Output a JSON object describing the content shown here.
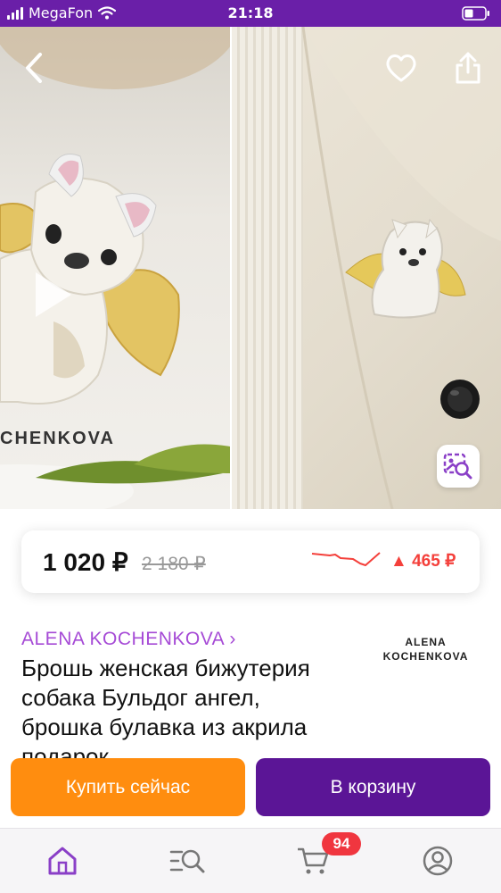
{
  "status_bar": {
    "carrier": "MegaFon",
    "time": "21:18",
    "icons": [
      "signal-icon",
      "wifi-icon",
      "battery-icon"
    ]
  },
  "gallery": {
    "watermark": "CHENKOVA",
    "icons": {
      "back": "chevron-left-icon",
      "favorite": "heart-icon",
      "share": "share-icon",
      "visual_search": "image-search-icon"
    }
  },
  "price": {
    "current": "1 020 ₽",
    "old": "2 180 ₽",
    "change": "▲ 465 ₽",
    "trend_color": "#f4403b"
  },
  "product": {
    "brand_link": "ALENA KOCHENKOVA ›",
    "brand_logo_line1": "ALENA",
    "brand_logo_line2": "KOCHENKOVA",
    "title": "Брошь женская бижутерия собака Бульдог ангел, брошка булавка из акрила подарок"
  },
  "actions": {
    "buy_now": "Купить сейчас",
    "add_to_cart": "В корзину"
  },
  "tab_bar": {
    "items": [
      "home-icon",
      "catalog-search-icon",
      "cart-icon",
      "profile-icon"
    ],
    "cart_count": "94"
  },
  "colors": {
    "brand_purple": "#6a1fa8",
    "buy_orange": "#ff8d0f",
    "cart_purple": "#5b1596",
    "brand_link": "#a64bd6",
    "badge_red": "#f0363f"
  }
}
